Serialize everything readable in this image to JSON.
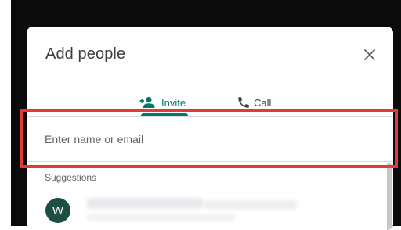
{
  "dialog": {
    "title": "Add people",
    "close_icon": "close-icon"
  },
  "tabs": [
    {
      "label": "Invite",
      "icon": "person-add-icon",
      "selected": true
    },
    {
      "label": "Call",
      "icon": "phone-icon",
      "selected": false
    }
  ],
  "search": {
    "placeholder": "Enter name or email",
    "value": ""
  },
  "suggestions": {
    "label": "Suggestions",
    "items": [
      {
        "initial": "W",
        "avatar_color": "#1e4d41"
      }
    ]
  },
  "colors": {
    "accent": "#00796b",
    "highlight": "#e53935"
  }
}
